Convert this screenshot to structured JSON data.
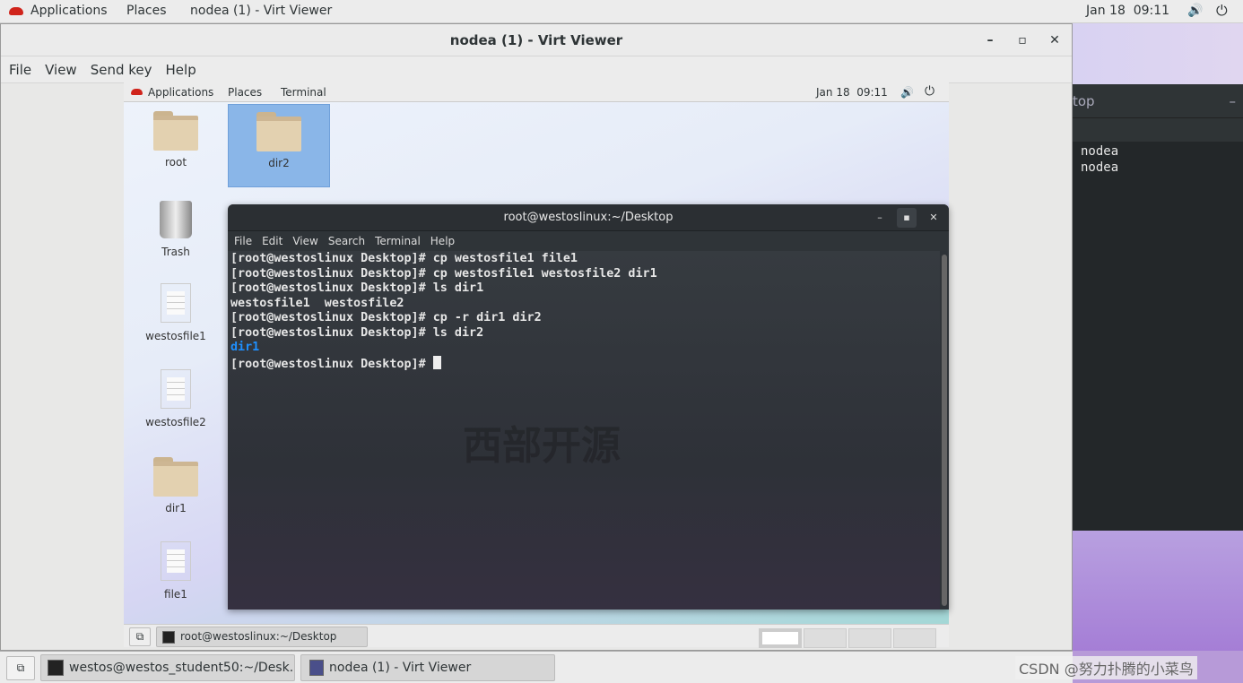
{
  "host_topbar": {
    "applications": "Applications",
    "places": "Places",
    "active_app": "nodea (1) - Virt Viewer",
    "clock": "Jan 18  09:11"
  },
  "virt_viewer": {
    "title": "nodea (1) - Virt Viewer",
    "menu": [
      "File",
      "View",
      "Send key",
      "Help"
    ]
  },
  "vm": {
    "topbar": {
      "applications": "Applications",
      "places": "Places",
      "terminal": "Terminal",
      "clock": "Jan 18  09:11"
    },
    "desktop_icons": [
      {
        "label": "root"
      },
      {
        "label": "dir2",
        "selected": true
      },
      {
        "label": "Trash"
      },
      {
        "label": "westosfile1"
      },
      {
        "label": "westosfile2"
      },
      {
        "label": "dir1"
      },
      {
        "label": "file1"
      }
    ],
    "terminal": {
      "title": "root@westoslinux:~/Desktop",
      "menu": [
        "File",
        "Edit",
        "View",
        "Search",
        "Terminal",
        "Help"
      ],
      "lines": [
        "[root@westoslinux Desktop]# cp westosfile1 file1",
        "[root@westoslinux Desktop]# cp westosfile1 westosfile2 dir1",
        "[root@westoslinux Desktop]# ls dir1",
        "westosfile1  westosfile2",
        "[root@westoslinux Desktop]# cp -r dir1 dir2",
        "[root@westoslinux Desktop]# ls dir2"
      ],
      "dir_output": "dir1",
      "dir_color": "#1e90ff",
      "prompt": "[root@westoslinux Desktop]# ",
      "watermark": "西部开源"
    },
    "taskbar": {
      "window": "root@westoslinux:~/Desktop"
    }
  },
  "background_terminal": {
    "title_fragment": "top",
    "lines": [
      "nodea",
      "nodea"
    ]
  },
  "host_taskbar": {
    "items": [
      "westos@westos_student50:~/Desk...",
      "nodea (1) - Virt Viewer"
    ]
  },
  "watermark": "CSDN @努力扑腾的小菜鸟"
}
